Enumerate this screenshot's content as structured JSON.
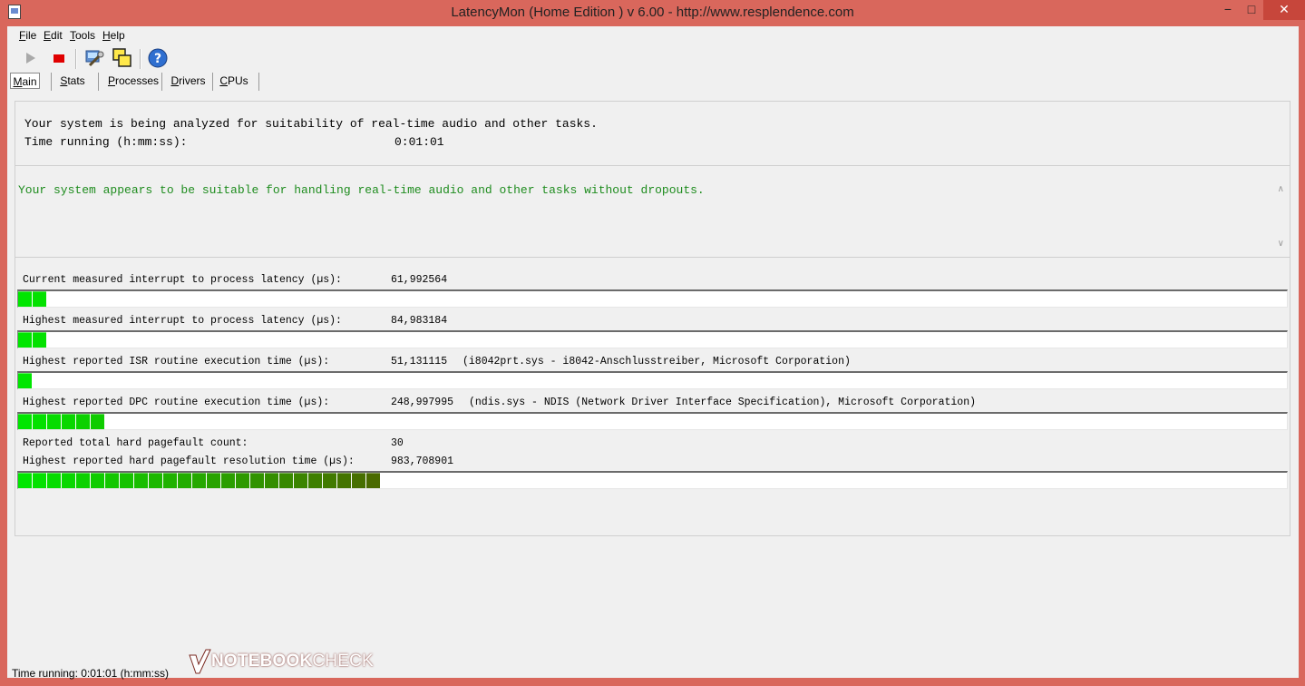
{
  "window": {
    "title": "LatencyMon  (Home Edition )  v 6.00 - http://www.resplendence.com",
    "minimize": "−",
    "maximize": "□",
    "close": "✕"
  },
  "menu": [
    {
      "label_u": "F",
      "label_rest": "ile"
    },
    {
      "label_u": "E",
      "label_rest": "dit"
    },
    {
      "label_u": "T",
      "label_rest": "ools"
    },
    {
      "label_u": "H",
      "label_rest": "elp"
    }
  ],
  "toolbar": {
    "icons": [
      "play-icon",
      "stop-icon",
      "wrench-icon",
      "windows-icon",
      "help-icon"
    ]
  },
  "tabs": [
    {
      "label_u": "M",
      "label_rest": "ain",
      "active": true
    },
    {
      "label_u": "S",
      "label_rest": "tats",
      "active": false
    },
    {
      "label_u": "P",
      "label_rest": "rocesses",
      "active": false
    },
    {
      "label_u": "D",
      "label_rest": "rivers",
      "active": false
    },
    {
      "label_u": "C",
      "label_rest": "PUs",
      "active": false
    }
  ],
  "status_panel": {
    "line1": "Your system is being analyzed for suitability of real-time audio and other tasks.",
    "time_label": "Time running (h:mm:ss):",
    "time_value": "0:01:01"
  },
  "verdict": {
    "text": "Your system appears to be suitable for handling real-time audio and other tasks without dropouts.",
    "color": "#1e8c1e"
  },
  "metrics": [
    {
      "label": "Current measured interrupt to process latency (µs):",
      "value": "61,992564",
      "detail": "",
      "bar_segments": 2
    },
    {
      "label": "Highest measured interrupt to process latency (µs):",
      "value": "84,983184",
      "detail": "",
      "bar_segments": 2
    },
    {
      "label": "Highest reported ISR routine execution time (µs):",
      "value": "51,131115",
      "detail": "(i8042prt.sys - i8042-Anschlusstreiber, Microsoft Corporation)",
      "bar_segments": 1
    },
    {
      "label": "Highest reported DPC routine execution time (µs):",
      "value": "248,997995",
      "detail": "(ndis.sys - NDIS (Network Driver Interface Specification), Microsoft Corporation)",
      "bar_segments": 6
    }
  ],
  "pagefault": {
    "count_label": "Reported total hard pagefault count:",
    "count_value": "30",
    "resolution_label": "Highest reported hard pagefault resolution time (µs):",
    "resolution_value": "983,708901",
    "bar_segments": 25
  },
  "statusbar": {
    "text": "Time running: 0:01:01  (h:mm:ss)"
  },
  "watermark": {
    "text_bold": "NOTEBOOK",
    "text_thin": "CHECK"
  },
  "colors": {
    "bar_start": "#00e600",
    "bar_end": "#4a6a00"
  }
}
